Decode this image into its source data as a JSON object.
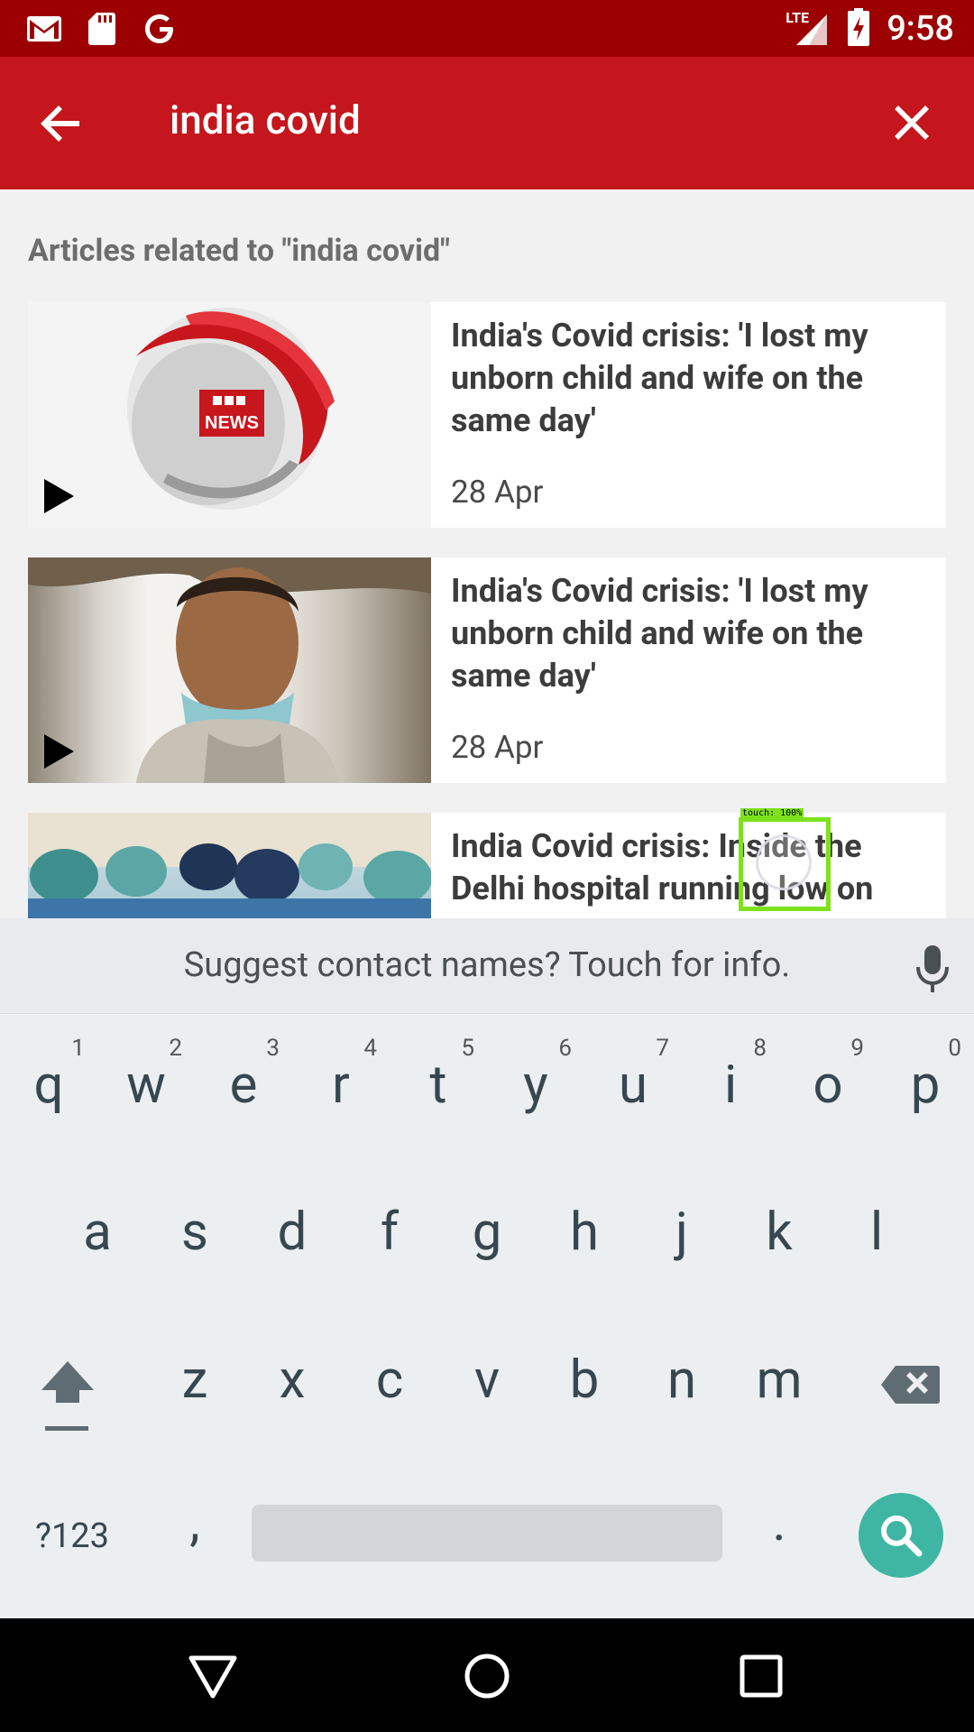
{
  "status_bar": {
    "time": "9:58",
    "network": "LTE",
    "icons": [
      "gmail-icon",
      "sd-card-icon",
      "google-icon",
      "signal-icon",
      "battery-charging-icon"
    ]
  },
  "app_bar": {
    "query": "india covid",
    "back_icon": "arrow-back-icon",
    "clear_icon": "close-icon"
  },
  "results": {
    "section_title": "Articles related to \"india covid\"",
    "articles": [
      {
        "headline": "India's Covid crisis: 'I lost my unborn child and wife on the same day'",
        "date": "28 Apr",
        "thumbnail": "bbc-news-logo",
        "video": true
      },
      {
        "headline": "India's Covid crisis: 'I lost my unborn child and wife on the same day'",
        "date": "28 Apr",
        "thumbnail": "man-with-mask",
        "video": true
      },
      {
        "headline": "India Covid crisis: Inside the Delhi hospital running low on",
        "date": "",
        "thumbnail": "hospital-staff",
        "video": false
      }
    ]
  },
  "touch_overlay": {
    "label": "touch: 100%"
  },
  "keyboard": {
    "suggestion": "Suggest contact names? Touch for info.",
    "row1": [
      {
        "key": "q",
        "num": "1"
      },
      {
        "key": "w",
        "num": "2"
      },
      {
        "key": "e",
        "num": "3"
      },
      {
        "key": "r",
        "num": "4"
      },
      {
        "key": "t",
        "num": "5"
      },
      {
        "key": "y",
        "num": "6"
      },
      {
        "key": "u",
        "num": "7"
      },
      {
        "key": "i",
        "num": "8"
      },
      {
        "key": "o",
        "num": "9"
      },
      {
        "key": "p",
        "num": "0"
      }
    ],
    "row2": [
      "a",
      "s",
      "d",
      "f",
      "g",
      "h",
      "j",
      "k",
      "l"
    ],
    "row3": [
      "z",
      "x",
      "c",
      "v",
      "b",
      "n",
      "m"
    ],
    "symbols_key": "?123",
    "comma_key": ",",
    "period_key": ".",
    "accent_color": "#3fb5a3"
  },
  "colors": {
    "status_bar": "#9c0000",
    "app_bar": "#c4161c",
    "keyboard_bg": "#eceff1"
  }
}
